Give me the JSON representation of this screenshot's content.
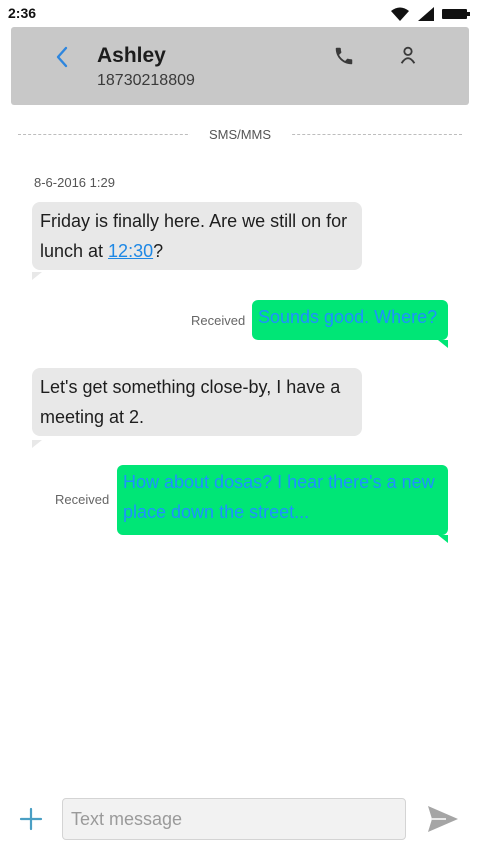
{
  "status_bar": {
    "time": "2:36"
  },
  "header": {
    "contact_name": "Ashley",
    "contact_number": "18730218809"
  },
  "thread": {
    "divider_label": "SMS/MMS",
    "date": "8-6-2016 1:29",
    "messages": [
      {
        "direction": "incoming",
        "text_before": "Friday is finally here. Are we still on for lunch at ",
        "link": "12:30",
        "text_after": "?"
      },
      {
        "direction": "outgoing",
        "text": "Sounds good. Where?",
        "status": "Received"
      },
      {
        "direction": "incoming",
        "text": "Let's get something close-by, I have a meeting at 2."
      },
      {
        "direction": "outgoing",
        "text": "How about dosas? I hear there's a new place down the street...",
        "status": "Received"
      }
    ]
  },
  "composer": {
    "placeholder": "Text message"
  },
  "colors": {
    "header_bg": "#c8c8c8",
    "incoming_bg": "#e8e8e8",
    "outgoing_bg": "#00e676",
    "outgoing_text": "#1e90ff",
    "accent": "#2e86de"
  }
}
